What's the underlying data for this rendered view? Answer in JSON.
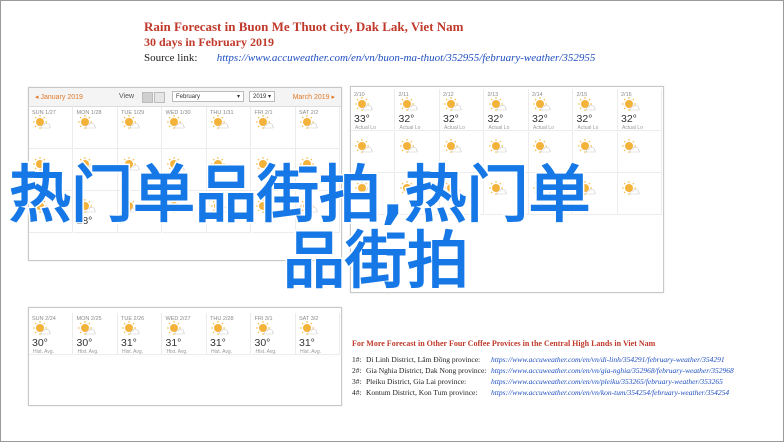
{
  "header": {
    "title": "Rain Forecast in Buon Me Thuot city, Dak Lak, Viet Nam",
    "subtitle": "30 days in February 2019",
    "source_label": "Source link:",
    "source_url": "https://www.accuweather.com/en/vn/buon-ma-thuot/352955/february-weather/352955"
  },
  "calendar": {
    "prev_month": "January 2019",
    "view_label": "View",
    "month_select": "February",
    "year_select": "2019",
    "next_month": "March 2019"
  },
  "panel1_days": [
    {
      "label": "SUN 1/27",
      "temp": "",
      "low": ""
    },
    {
      "label": "MON 1/28",
      "temp": "",
      "low": ""
    },
    {
      "label": "TUE 1/29",
      "temp": "",
      "low": ""
    },
    {
      "label": "WED 1/30",
      "temp": "",
      "low": ""
    },
    {
      "label": "THU 1/31",
      "temp": "",
      "low": ""
    },
    {
      "label": "FRI 2/1",
      "temp": "",
      "low": ""
    },
    {
      "label": "SAT 2/2",
      "temp": "",
      "low": ""
    },
    {
      "label": "",
      "temp": "",
      "low": ""
    },
    {
      "label": "",
      "temp": "",
      "low": ""
    },
    {
      "label": "",
      "temp": "",
      "low": ""
    },
    {
      "label": "",
      "temp": "",
      "low": ""
    },
    {
      "label": "",
      "temp": "",
      "low": ""
    },
    {
      "label": "",
      "temp": "",
      "low": ""
    },
    {
      "label": "",
      "temp": "",
      "low": ""
    },
    {
      "label": "",
      "temp": "",
      "low": ""
    },
    {
      "label": "",
      "temp": "28°",
      "low": ""
    },
    {
      "label": "",
      "temp": "",
      "low": ""
    },
    {
      "label": "",
      "temp": "",
      "low": ""
    },
    {
      "label": "",
      "temp": "",
      "low": ""
    },
    {
      "label": "",
      "temp": "",
      "low": ""
    },
    {
      "label": "",
      "temp": "",
      "low": ""
    }
  ],
  "panel2_days": [
    {
      "label": "2/10",
      "temp": "33°",
      "low": "Actual Lo"
    },
    {
      "label": "2/11",
      "temp": "32°",
      "low": "Actual Lo"
    },
    {
      "label": "2/12",
      "temp": "32°",
      "low": "Actual Lo"
    },
    {
      "label": "2/13",
      "temp": "32°",
      "low": "Actual Lo"
    },
    {
      "label": "2/14",
      "temp": "32°",
      "low": "Actual Lo"
    },
    {
      "label": "2/15",
      "temp": "32°",
      "low": "Actual Lo"
    },
    {
      "label": "2/16",
      "temp": "32°",
      "low": "Actual Lo"
    },
    {
      "label": "",
      "temp": "",
      "low": ""
    },
    {
      "label": "",
      "temp": "",
      "low": ""
    },
    {
      "label": "",
      "temp": "",
      "low": ""
    },
    {
      "label": "",
      "temp": "",
      "low": ""
    },
    {
      "label": "",
      "temp": "",
      "low": ""
    },
    {
      "label": "",
      "temp": "",
      "low": ""
    },
    {
      "label": "",
      "temp": "",
      "low": ""
    },
    {
      "label": "",
      "temp": "",
      "low": ""
    },
    {
      "label": "",
      "temp": "",
      "low": ""
    },
    {
      "label": "",
      "temp": "",
      "low": ""
    },
    {
      "label": "",
      "temp": "",
      "low": ""
    },
    {
      "label": "",
      "temp": "",
      "low": ""
    },
    {
      "label": "",
      "temp": "",
      "low": ""
    },
    {
      "label": "",
      "temp": "",
      "low": ""
    }
  ],
  "panel3_days": [
    {
      "label": "SUN 2/24",
      "temp": "30°",
      "low": "Hist. Avg."
    },
    {
      "label": "MON 2/25",
      "temp": "30°",
      "low": "Hist. Avg."
    },
    {
      "label": "TUE 2/26",
      "temp": "31°",
      "low": "Hist. Avg."
    },
    {
      "label": "WED 2/27",
      "temp": "31°",
      "low": "Hist. Avg."
    },
    {
      "label": "THU 2/28",
      "temp": "31°",
      "low": "Hist. Avg."
    },
    {
      "label": "FRI 3/1",
      "temp": "30°",
      "low": "Hist. Avg."
    },
    {
      "label": "SAT 3/2",
      "temp": "31°",
      "low": "Hist. Avg."
    }
  ],
  "more_forecast": {
    "title": "For More Forecast in Other Four Coffee Provices in the Central High Lands in Viet Nam",
    "rows": [
      {
        "num": "1#:",
        "name": "Di Linh District, Lâm Đồng province:",
        "url": "https://www.accuweather.com/en/vn/di-linh/354291/february-weather/354291"
      },
      {
        "num": "2#:",
        "name": "Gia Nghia District, Dak Nong province:",
        "url": "https://www.accuweather.com/en/vn/gia-nghia/352968/february-weather/352968"
      },
      {
        "num": "3#:",
        "name": "Pleiku District, Gia Lai province:",
        "url": "https://www.accuweather.com/en/vn/pleiku/353265/february-weather/353265"
      },
      {
        "num": "4#:",
        "name": "Kontum District, Kon Tum province:",
        "url": "https://www.accuweather.com/en/vn/kon-tum/354254/february-weather/354254"
      }
    ]
  },
  "overlay": {
    "line1": "热门单品街拍,热门单",
    "line2": "品街拍"
  },
  "colors": {
    "title_red": "#c0392b",
    "link_blue": "#1f4fbf",
    "overlay_blue": "#1678e6",
    "accent_orange": "#e07a2a",
    "sun_yellow": "#f3b23a"
  }
}
